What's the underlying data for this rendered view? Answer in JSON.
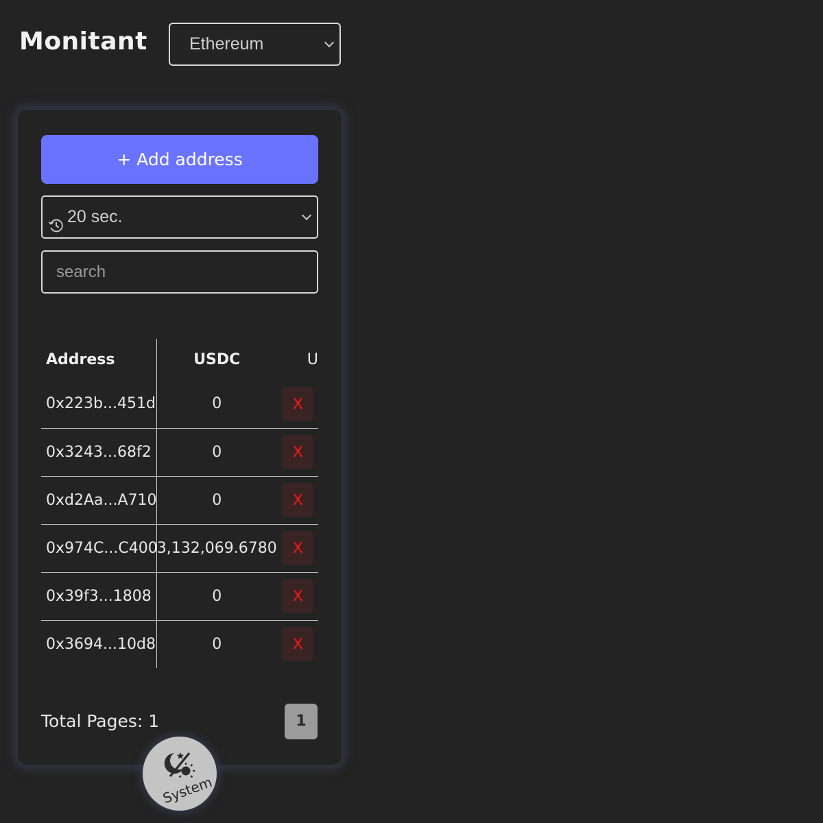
{
  "header": {
    "title": "Monitant",
    "network_select": {
      "value": "Ethereum"
    }
  },
  "controls": {
    "add_label": "+ Add address",
    "interval_value": "20 sec.",
    "search_placeholder": "search"
  },
  "table": {
    "columns": [
      "Address",
      "USDC",
      "U"
    ],
    "delete_label": "X",
    "rows": [
      {
        "address": "0x223b...451d",
        "usdc": "0"
      },
      {
        "address": "0x3243...68f2",
        "usdc": "0"
      },
      {
        "address": "0xd2Aa...A710",
        "usdc": "0"
      },
      {
        "address": "0x974C...C400",
        "usdc": "3,132,069.6780"
      },
      {
        "address": "0x39f3...1808",
        "usdc": "0"
      },
      {
        "address": "0x3694...10d8",
        "usdc": "0"
      }
    ]
  },
  "pagination": {
    "total_label": "Total Pages: 1",
    "current_page": "1"
  },
  "theme_toggle": {
    "label": "System"
  },
  "colors": {
    "background": "#232323",
    "accent": "#6a73ff",
    "delete": "#ff1818",
    "delete_bg": "#3a2323",
    "page_btn": "#9b9b9b"
  },
  "icons": {
    "network_dropdown": "chevron-down-icon",
    "interval": "clock-history-icon",
    "interval_dropdown": "chevron-down-icon",
    "theme": "moon-sun-icon"
  }
}
